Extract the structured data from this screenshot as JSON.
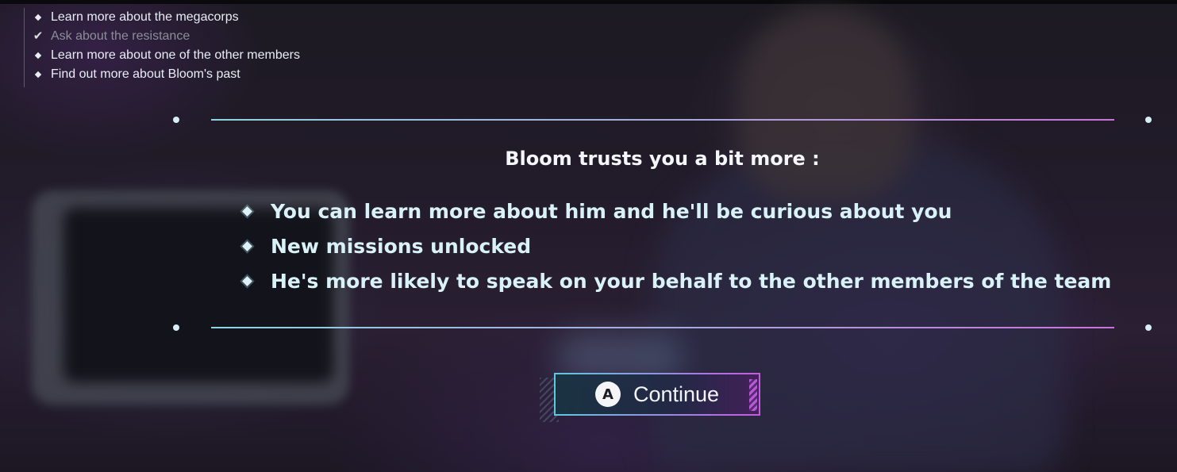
{
  "objectives": [
    {
      "label": "Learn more about the megacorps",
      "done": false
    },
    {
      "label": "Ask about the resistance",
      "done": true
    },
    {
      "label": "Learn more about one of the other members",
      "done": false
    },
    {
      "label": "Find out more about Bloom's past",
      "done": false
    }
  ],
  "panel": {
    "headline": "Bloom trusts you a bit more :",
    "benefits": [
      "You can learn more about him and he'll be curious about you",
      "New missions unlocked",
      "He's more likely to speak on your behalf to the other members of the team"
    ]
  },
  "continue_button": {
    "key": "A",
    "label": "Continue"
  },
  "colors": {
    "line_start": "#8ed3e6",
    "line_end": "#c873d8",
    "benefit_text": "#d9f2f8",
    "objective_done": "#8a8f98"
  },
  "icons": {
    "objective": "diamond-bullet-icon",
    "objective_done": "checkmark-icon",
    "benefit": "diamond-bullet-icon"
  }
}
